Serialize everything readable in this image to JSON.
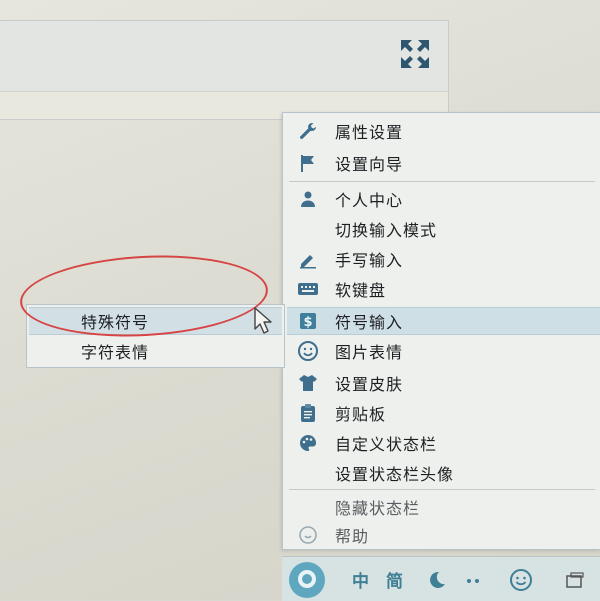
{
  "menu": {
    "items": [
      {
        "id": "properties",
        "label": "属性设置",
        "icon": "wrench-icon"
      },
      {
        "id": "wizard",
        "label": "设置向导",
        "icon": "flag-icon"
      },
      {
        "id": "personal",
        "label": "个人中心",
        "icon": "person-icon"
      },
      {
        "id": "switch-mode",
        "label": "切换输入模式",
        "icon": ""
      },
      {
        "id": "handwriting",
        "label": "手写输入",
        "icon": "pencil-icon"
      },
      {
        "id": "soft-keyboard",
        "label": "软键盘",
        "icon": "keyboard-icon"
      },
      {
        "id": "symbol-input",
        "label": "符号输入",
        "icon": "dollar-icon"
      },
      {
        "id": "emoji",
        "label": "图片表情",
        "icon": "smiley-icon"
      },
      {
        "id": "skin",
        "label": "设置皮肤",
        "icon": "shirt-icon"
      },
      {
        "id": "clipboard",
        "label": "剪贴板",
        "icon": "clipboard-icon"
      },
      {
        "id": "custom-status",
        "label": "自定义状态栏",
        "icon": "palette-icon"
      },
      {
        "id": "status-avatar",
        "label": "设置状态栏头像",
        "icon": ""
      },
      {
        "id": "hide-status",
        "label": "隐藏状态栏",
        "icon": ""
      },
      {
        "id": "help",
        "label": "帮助",
        "icon": "help-icon"
      }
    ]
  },
  "submenu": {
    "items": [
      {
        "label": "特殊符号"
      },
      {
        "label": "字符表情"
      }
    ]
  },
  "toolbar": {
    "lang": "中",
    "width": "简"
  },
  "colors": {
    "highlight": "#cfdfe6",
    "icon": "#3f6f8c",
    "annotation": "#d64444",
    "toolbar_accent": "#3f7f95"
  }
}
